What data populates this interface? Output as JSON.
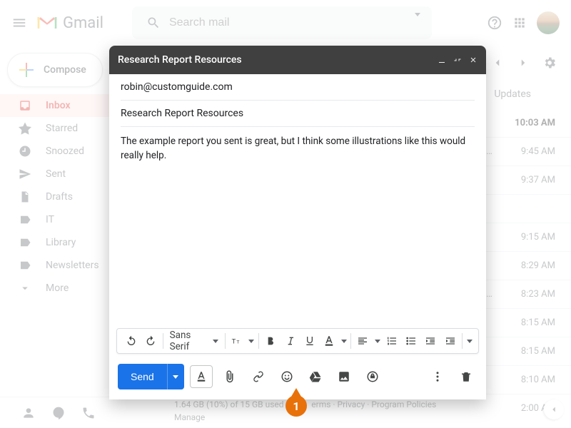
{
  "header": {
    "product_name": "Gmail",
    "search_placeholder": "Search mail"
  },
  "sidebar": {
    "compose_label": "Compose",
    "items": [
      {
        "label": "Inbox",
        "icon": "inbox-icon"
      },
      {
        "label": "Starred",
        "icon": "star-icon"
      },
      {
        "label": "Snoozed",
        "icon": "clock-icon"
      },
      {
        "label": "Sent",
        "icon": "send-icon"
      },
      {
        "label": "Drafts",
        "icon": "file-icon"
      },
      {
        "label": "IT",
        "icon": "label-icon"
      },
      {
        "label": "Library",
        "icon": "label-icon"
      },
      {
        "label": "Newsletters",
        "icon": "label-icon"
      },
      {
        "label": "More",
        "icon": "chevron-down-icon"
      }
    ]
  },
  "inbox_tabs": {
    "visible_tab_label": "Updates"
  },
  "list_rows": [
    {
      "snippet": "",
      "time": "10:03 AM",
      "bold": true
    },
    {
      "snippet": "…",
      "time": "9:45 AM"
    },
    {
      "snippet": "",
      "time": "9:37 AM"
    },
    {
      "snippet": "",
      "time": ""
    },
    {
      "snippet": "",
      "time": "9:15 AM"
    },
    {
      "snippet": "",
      "time": "8:29 AM"
    },
    {
      "snippet": "…",
      "time": "8:23 AM"
    },
    {
      "snippet": "",
      "time": "8:15 AM"
    },
    {
      "snippet": "",
      "time": "8:15 AM"
    },
    {
      "snippet": "",
      "time": "8:10 AM"
    },
    {
      "snippet": "",
      "time": "2:00 AM"
    }
  ],
  "compose_window": {
    "title": "Research Report Resources",
    "to": "robin@customguide.com",
    "subject": "Research Report Resources",
    "body": "The example report you sent is great, but I think some illustrations like this would really help.",
    "font_family_label": "Sans Serif",
    "send_label": "Send"
  },
  "footer": {
    "storage_line": "1.64 GB (10%) of 15 GB used",
    "storage_manage": "Manage",
    "links_terms": "erms",
    "links_privacy": "Privacy",
    "links_policies": "Program Policies",
    "sep": " · "
  },
  "callout": {
    "number": "1"
  }
}
